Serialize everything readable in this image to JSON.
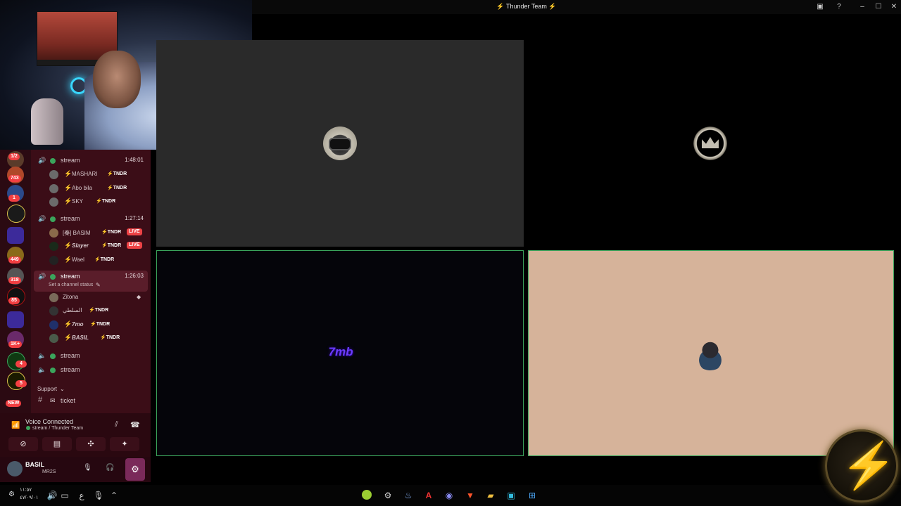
{
  "window": {
    "title": "Thunder Team"
  },
  "channels": [
    {
      "name": "stream",
      "time": "1:48:01",
      "users": [
        {
          "name": "MASHARI",
          "tag": "TNDR"
        },
        {
          "name": "Abo bila",
          "tag": "TNDR"
        },
        {
          "name": "SKY",
          "tag": "TNDR"
        }
      ]
    },
    {
      "name": "stream",
      "time": "1:27:14",
      "users": [
        {
          "name": "[秦] BASIM",
          "tag": "TNDR",
          "live": "LIVE"
        },
        {
          "name": "Slayer",
          "tag": "TNDR",
          "live": "LIVE"
        },
        {
          "name": "Wael",
          "tag": "TNDR"
        }
      ]
    },
    {
      "name": "stream",
      "time": "1:26:03",
      "status": "Set a channel status",
      "users": [
        {
          "name": "Zitona",
          "tag": ""
        },
        {
          "name": "السلطي",
          "tag": "TNDR"
        },
        {
          "name": "7mo",
          "tag": "TNDR"
        },
        {
          "name": "BASIL",
          "tag": "TNDR"
        }
      ]
    },
    {
      "name": "stream"
    },
    {
      "name": "stream"
    }
  ],
  "category": "Support",
  "text_channel": "ticket",
  "server_badges": [
    "1/2",
    "743",
    "1",
    "449",
    "318",
    "85",
    "1K+",
    "4",
    "5",
    "NEW"
  ],
  "voice": {
    "status": "Voice Connected",
    "channel": "stream / Thunder Team"
  },
  "user": {
    "name": "BASIL",
    "subtitle": "MR2S"
  },
  "tiles": [
    {
      "label": ""
    },
    {
      "label": ""
    },
    {
      "label": "7mb"
    },
    {
      "label": ""
    }
  ],
  "taskbar": {
    "time": "١١:٥٧",
    "date": "٤٧/٠٩/٠١",
    "lang": "ع"
  },
  "colors": {
    "speaking_border": "#3ba55c",
    "live_badge": "#ed4245",
    "sidebar": "#3b0d17"
  }
}
